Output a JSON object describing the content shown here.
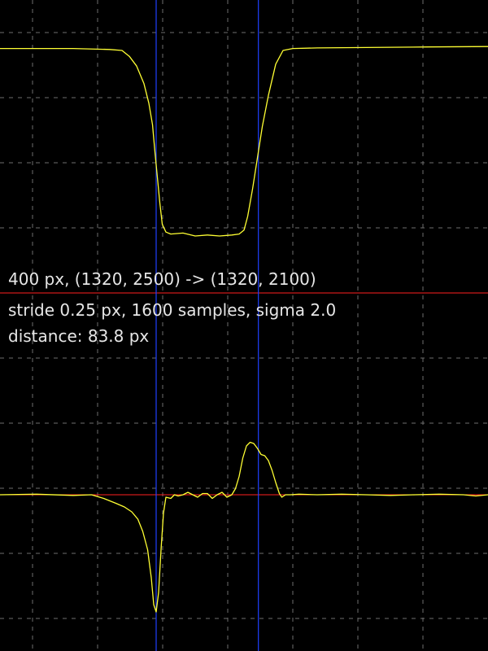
{
  "info": {
    "line1": "400 px, (1320, 2500) -> (1320, 2100)",
    "line2": "stride 0.25 px, 1600 samples, sigma 2.0",
    "line3": "distance: 83.8 px"
  },
  "colors": {
    "background": "#000000",
    "grid": "#6e6e6e",
    "profile": "#ffff33",
    "zero_line": "#ff2020",
    "edge_marker": "#2040ff",
    "text": "#e6e6e6"
  },
  "chart_data": [
    {
      "type": "line",
      "panel": "intensity-profile",
      "title": "",
      "xlabel": "",
      "ylabel": "",
      "xlim": [
        0,
        400
      ],
      "ylim": [
        0,
        1
      ],
      "grid": true,
      "edge_markers_x": [
        128,
        211.8
      ],
      "series": [
        {
          "x": [
            0,
            60,
            90,
            100,
            106,
            112,
            118,
            122,
            125,
            127,
            129,
            131,
            133,
            136,
            140,
            150,
            160,
            170,
            180,
            190,
            196,
            200,
            203,
            207,
            211,
            215,
            220,
            226,
            232,
            240,
            260,
            300,
            350,
            400
          ],
          "y": [
            0.96,
            0.96,
            0.955,
            0.95,
            0.92,
            0.87,
            0.78,
            0.68,
            0.57,
            0.43,
            0.3,
            0.17,
            0.06,
            0.02,
            0.01,
            0.015,
            0.0,
            0.005,
            0.0,
            0.005,
            0.01,
            0.03,
            0.1,
            0.24,
            0.4,
            0.56,
            0.72,
            0.88,
            0.95,
            0.96,
            0.963,
            0.965,
            0.968,
            0.97
          ]
        }
      ]
    },
    {
      "type": "line",
      "panel": "derivative-profile",
      "title": "",
      "xlabel": "",
      "ylabel": "",
      "xlim": [
        0,
        400
      ],
      "ylim": [
        -1,
        0.6
      ],
      "grid": true,
      "zero_line": true,
      "edge_markers_x": [
        128,
        211.8
      ],
      "series": [
        {
          "x": [
            0,
            30,
            60,
            75,
            85,
            95,
            102,
            108,
            113,
            117,
            121,
            124,
            126,
            128,
            130,
            132,
            134,
            136,
            140,
            143,
            146,
            150,
            154,
            158,
            162,
            166,
            170,
            174,
            178,
            182,
            186,
            190,
            193,
            196,
            199,
            202,
            205,
            208,
            211,
            214,
            217,
            220,
            223,
            226,
            229,
            231,
            234,
            238,
            245,
            260,
            280,
            300,
            320,
            340,
            360,
            380,
            390,
            400
          ],
          "y": [
            0,
            0.005,
            -0.005,
            0,
            -0.03,
            -0.07,
            -0.1,
            -0.14,
            -0.2,
            -0.3,
            -0.45,
            -0.68,
            -0.9,
            -0.96,
            -0.8,
            -0.45,
            -0.15,
            -0.02,
            -0.03,
            0.0,
            -0.01,
            0.0,
            0.02,
            0.0,
            -0.02,
            0.01,
            0.01,
            -0.03,
            0.0,
            0.02,
            -0.02,
            0.0,
            0.05,
            0.15,
            0.3,
            0.4,
            0.43,
            0.42,
            0.38,
            0.33,
            0.32,
            0.28,
            0.2,
            0.1,
            0.01,
            -0.02,
            0.0,
            0.0,
            0.005,
            0.0,
            0.005,
            0.0,
            -0.005,
            0.0,
            0.005,
            0.0,
            -0.01,
            0.0
          ]
        }
      ]
    }
  ]
}
